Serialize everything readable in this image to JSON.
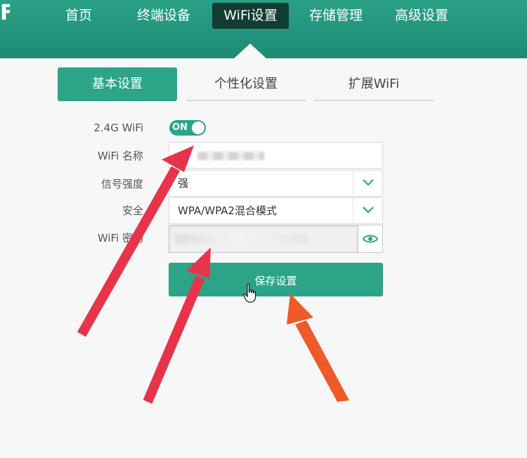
{
  "nav": {
    "items": [
      {
        "label": "首页"
      },
      {
        "label": "终端设备"
      },
      {
        "label": "WiFi设置"
      },
      {
        "label": "存储管理"
      },
      {
        "label": "高级设置"
      }
    ],
    "active_index": 2
  },
  "subtabs": [
    {
      "label": "基本设置"
    },
    {
      "label": "个性化设置"
    },
    {
      "label": "扩展WiFi"
    }
  ],
  "form": {
    "wifi_switch_label": "2.4G WiFi",
    "wifi_switch_state": "ON",
    "ssid_label": "WiFi 名称",
    "signal_label": "信号强度",
    "signal_value": "强",
    "security_label": "安全",
    "security_value": "WPA/WPA2混合模式",
    "password_label": "WiFi 密码",
    "save_label": "保存设置"
  },
  "colors": {
    "brand": "#2ba487",
    "nav_active": "#123d33",
    "annotation_red": "#e8344a",
    "annotation_orange": "#ee5a2a"
  }
}
